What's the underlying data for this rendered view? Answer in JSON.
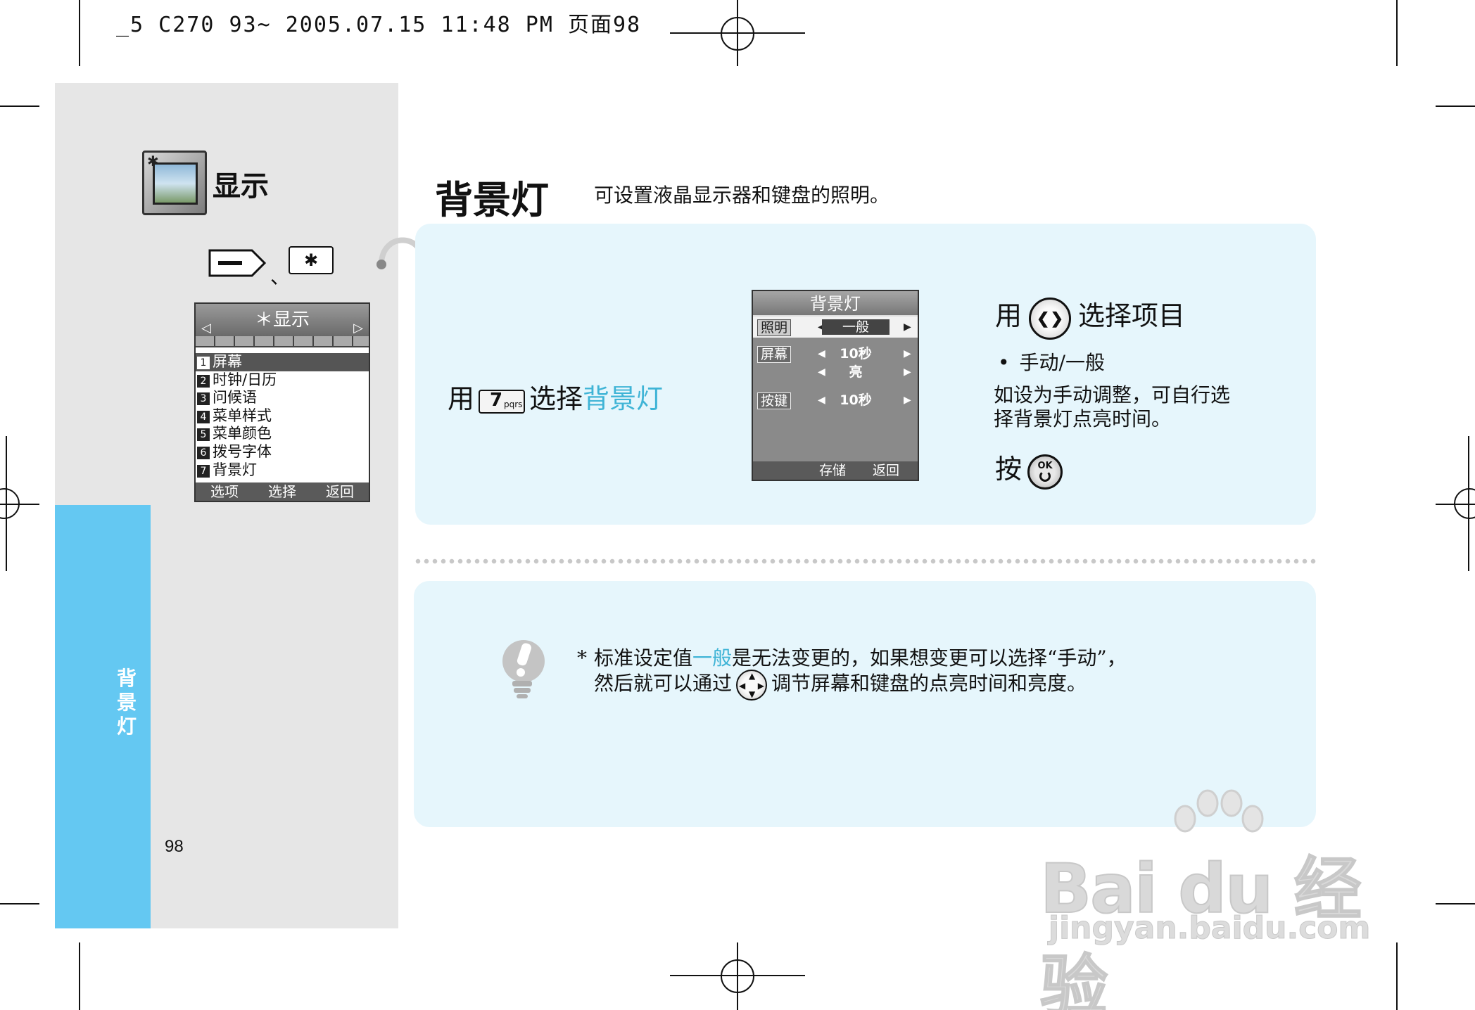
{
  "print_header": "_5 C270 93~ 2005.07.15 11:48 PM 页面98",
  "sidebar": {
    "section_title": "显示",
    "star_key_label": "✱",
    "separator": "、",
    "tab_label": "背景灯",
    "page_number": "98"
  },
  "menu_screen": {
    "title": "＊显示",
    "left_arrow": "◁",
    "right_arrow": "▷",
    "items": [
      {
        "num": "1",
        "label": "屏幕"
      },
      {
        "num": "2",
        "label": "时钟/日历"
      },
      {
        "num": "3",
        "label": "问候语"
      },
      {
        "num": "4",
        "label": "菜单样式"
      },
      {
        "num": "5",
        "label": "菜单颜色"
      },
      {
        "num": "6",
        "label": "拨号字体"
      },
      {
        "num": "7",
        "label": "背景灯"
      }
    ],
    "selected_index": 0,
    "softkeys": [
      "选项",
      "选择",
      "返回"
    ]
  },
  "heading": "背景灯",
  "description": "可设置液晶显示器和键盘的照明。",
  "step1": {
    "prefix": "用",
    "key_digit": "7",
    "key_letters": "pqrs",
    "middle": "选择",
    "highlight": "背景灯"
  },
  "backlight_screen": {
    "title": "背景灯",
    "rows": [
      {
        "label": "照明",
        "value": "一般"
      },
      {
        "label": "屏幕",
        "value": "10秒",
        "value2": "亮"
      },
      {
        "label": "按键",
        "value": "10秒"
      }
    ],
    "softkeys": [
      "存储",
      "返回"
    ]
  },
  "step2": {
    "prefix": "用",
    "suffix": "选择项目",
    "bullet": "手动/一般",
    "note_line1": "如设为手动调整，可自行选",
    "note_line2": "择背景灯点亮时间。",
    "press_label": "按",
    "ok_label": "OK"
  },
  "tip": {
    "asterisk": "*",
    "line1_a": "标准设定值",
    "line1_hl": "一般",
    "line1_b": "是无法变更的，如果想变更可以选择“手动”，",
    "line2_a": "然后就可以通过",
    "line2_b": "调节屏幕和键盘的点亮时间和亮度。"
  },
  "watermark": {
    "brand": "Bai du 经验",
    "url": "jingyan.baidu.com"
  },
  "colors": {
    "accent": "#3fb4d6",
    "tab_blue": "#64c8f2",
    "box_bg": "#e6f6fc",
    "side_gray": "#e6e6e6"
  }
}
